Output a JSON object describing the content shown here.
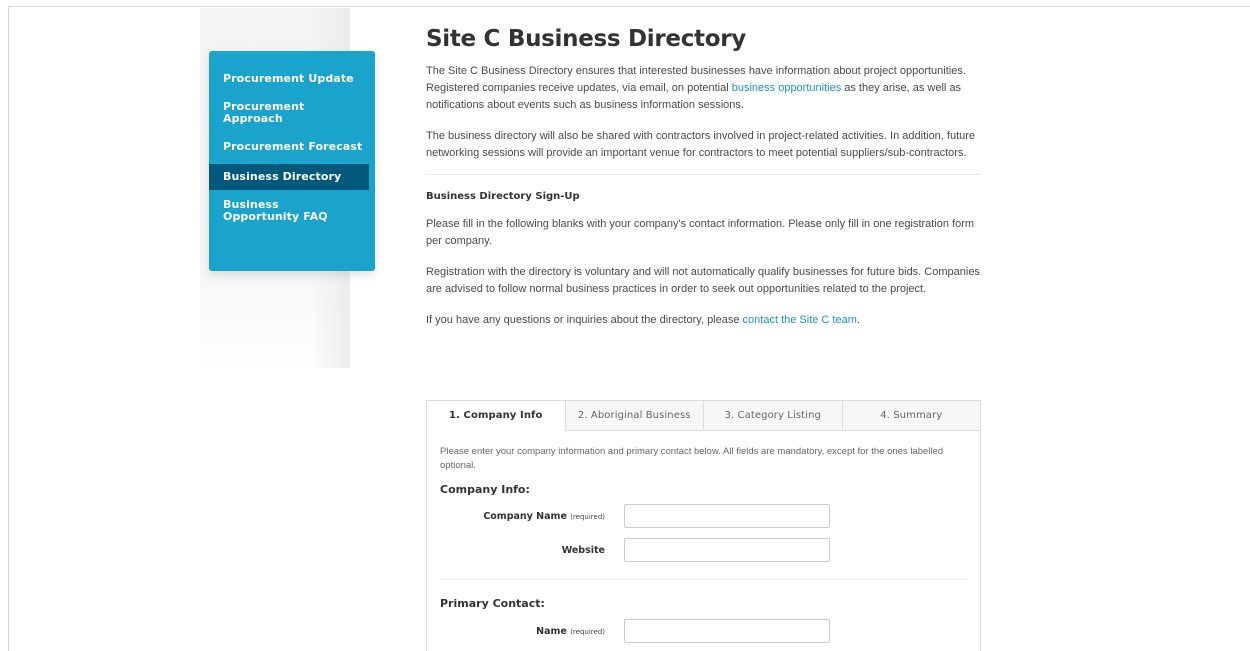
{
  "sidebar": {
    "items": [
      {
        "label": "Procurement Update"
      },
      {
        "label": "Procurement Approach"
      },
      {
        "label": "Procurement Forecast"
      },
      {
        "label": "Business Directory"
      },
      {
        "label": "Business Opportunity FAQ"
      }
    ]
  },
  "page": {
    "title": "Site C Business Directory",
    "p1_start": "The Site C Business Directory ensures that interested businesses have information about project opportunities. Registered companies receive updates, via email, on potential ",
    "p1_link": "business opportunities",
    "p1_end": " as they arise, as well as notifications about events such as business information sessions.",
    "p2": "The business directory will also be shared with contractors involved in project-related activities. In addition, future networking sessions will provide an important venue for contractors to meet potential suppliers/sub-contractors.",
    "signup_heading": "Business Directory Sign-Up",
    "p3": "Please fill in the following blanks with your company's contact information. Please only fill in one registration form per company.",
    "p4": "Registration with the directory is voluntary and will not automatically qualify businesses for future bids. Companies are advised to follow normal business practices in order to seek out opportunities related to the project.",
    "p5_start": "If you have any questions or inquiries about the directory, please ",
    "p5_link": "contact the Site C team",
    "p5_end": "."
  },
  "wizard": {
    "tabs": [
      {
        "label": "1. Company Info"
      },
      {
        "label": "2. Aboriginal Business"
      },
      {
        "label": "3. Category Listing"
      },
      {
        "label": "4. Summary"
      }
    ],
    "intro": "Please enter your company information and primary contact below. All fields are mandatory, except for the ones labelled optional.",
    "company_section": "Company Info:",
    "company_name_label": "Company Name",
    "required_tag": "(required)",
    "website_label": "Website",
    "contact_section": "Primary Contact:",
    "name_label": "Name"
  },
  "colors": {
    "sidebar_bg": "#1aa3cb",
    "sidebar_active": "#00587a",
    "link": "#1a94c4"
  }
}
